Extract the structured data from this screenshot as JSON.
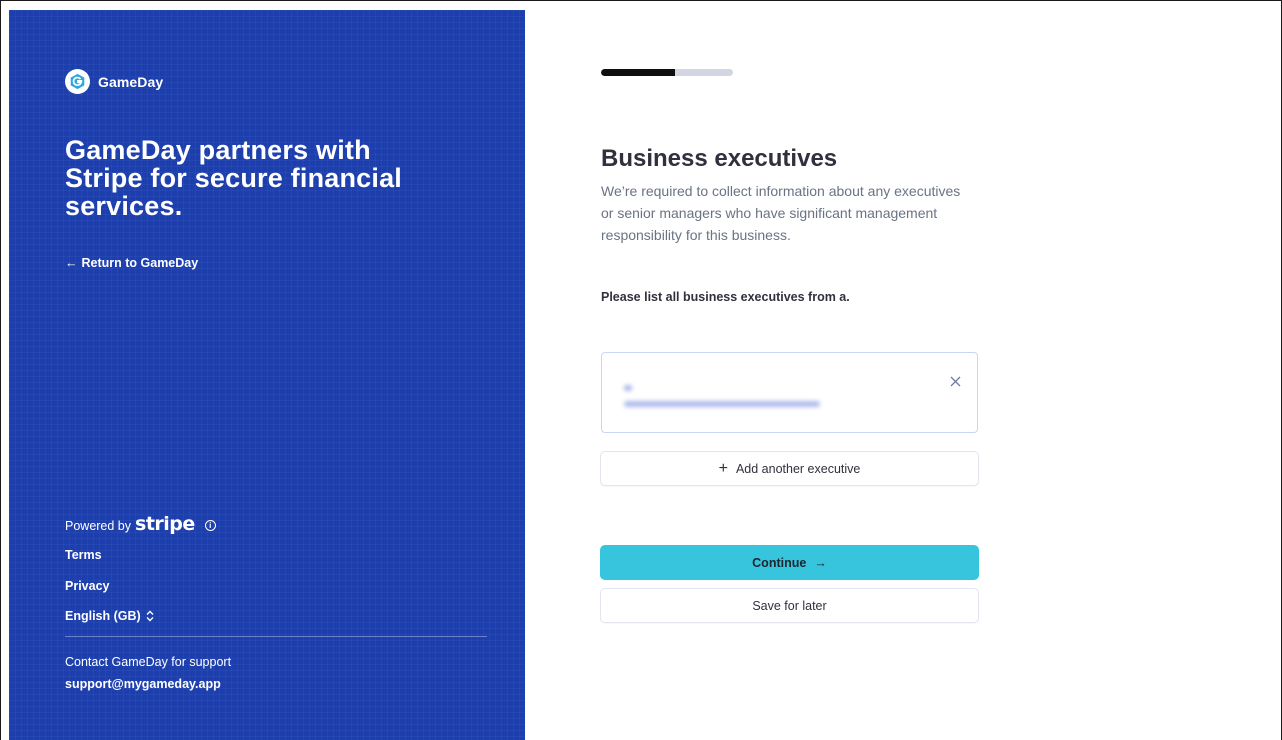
{
  "brand": {
    "name": "GameDay",
    "color": "#1d3fae"
  },
  "left_panel": {
    "headline": "GameDay partners with Stripe for secure financial services.",
    "return_link": "Return to GameDay",
    "powered_by": "Powered by",
    "stripe_word": "stripe",
    "terms": "Terms",
    "privacy": "Privacy",
    "language": "English (GB)",
    "support_text": "Contact GameDay for support",
    "support_email": "support@mygameday.app"
  },
  "progress": {
    "fraction": 0.56
  },
  "main": {
    "title": "Business executives",
    "description": "We’re required to collect information about any executives or senior managers who have significant management responsibility for this business.",
    "instruction": "Please list all business executives from a.",
    "add_button": "Add another executive",
    "continue_button": "Continue",
    "save_button": "Save for later",
    "accent_color": "#36c5dc"
  }
}
